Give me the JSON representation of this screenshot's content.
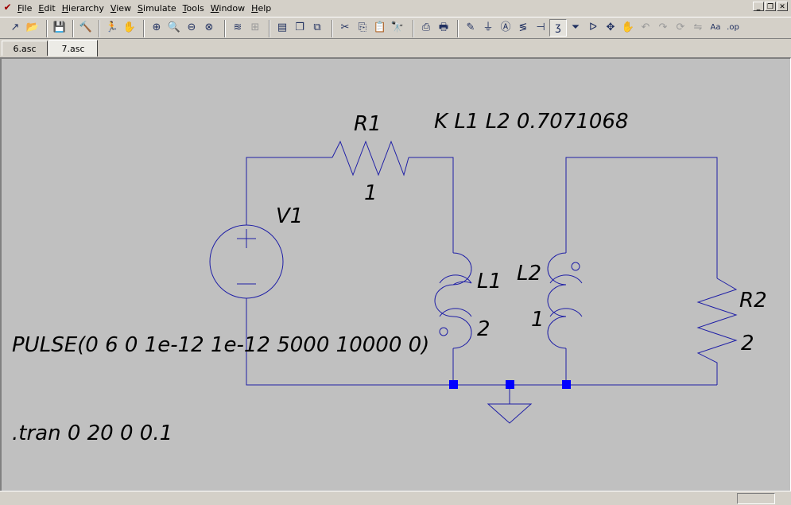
{
  "menu": {
    "items": [
      {
        "accel": "F",
        "rest": "ile"
      },
      {
        "accel": "E",
        "rest": "dit"
      },
      {
        "accel": "H",
        "rest": "ierarchy"
      },
      {
        "accel": "V",
        "rest": "iew"
      },
      {
        "accel": "S",
        "rest": "imulate"
      },
      {
        "accel": "T",
        "rest": "ools"
      },
      {
        "accel": "W",
        "rest": "indow"
      },
      {
        "accel": "H",
        "rest": "elp"
      }
    ]
  },
  "toolbar": {
    "groups": [
      [
        {
          "name": "run-icon",
          "glyph": "↗"
        },
        {
          "name": "open-icon",
          "glyph": "📂"
        }
      ],
      [
        {
          "name": "save-icon",
          "glyph": "💾"
        }
      ],
      [
        {
          "name": "control-panel-icon",
          "glyph": "🔨"
        }
      ],
      [
        {
          "name": "run-simulation-icon",
          "glyph": "🏃"
        },
        {
          "name": "halt-icon",
          "glyph": "✋",
          "gray": true
        }
      ],
      [
        {
          "name": "zoom-in-icon",
          "glyph": "⊕"
        },
        {
          "name": "zoom-area-icon",
          "glyph": "🔍",
          "gray": true
        },
        {
          "name": "zoom-out-icon",
          "glyph": "⊖"
        },
        {
          "name": "zoom-fit-icon",
          "glyph": "⊗"
        }
      ],
      [
        {
          "name": "waveform-icon",
          "glyph": "≋"
        },
        {
          "name": "autorange-icon",
          "glyph": "⊞",
          "gray": true
        }
      ],
      [
        {
          "name": "tile-horizontal-icon",
          "glyph": "▤"
        },
        {
          "name": "cascade-icon",
          "glyph": "❐"
        },
        {
          "name": "close-all-icon",
          "glyph": "⧉"
        }
      ],
      [
        {
          "name": "cut-icon",
          "glyph": "✂"
        },
        {
          "name": "copy-icon",
          "glyph": "⎘"
        },
        {
          "name": "paste-icon",
          "glyph": "📋"
        },
        {
          "name": "find-icon",
          "glyph": "🔭"
        }
      ],
      [
        {
          "name": "print-setup-icon",
          "glyph": "⎙"
        },
        {
          "name": "print-icon",
          "glyph": "🖶"
        }
      ],
      [
        {
          "name": "draw-wire-icon",
          "glyph": "✎"
        },
        {
          "name": "ground-icon",
          "glyph": "⏚"
        },
        {
          "name": "label-net-icon",
          "glyph": "Ⓐ"
        },
        {
          "name": "resistor-icon",
          "glyph": "≶"
        },
        {
          "name": "capacitor-icon",
          "glyph": "⊣"
        },
        {
          "name": "inductor-icon",
          "glyph": "ʒ",
          "active": true
        },
        {
          "name": "diode-icon",
          "glyph": "⏷"
        },
        {
          "name": "component-icon",
          "glyph": "ᐅ"
        },
        {
          "name": "move-icon",
          "glyph": "✥"
        },
        {
          "name": "drag-icon",
          "glyph": "✋"
        },
        {
          "name": "undo-icon",
          "glyph": "↶",
          "gray": true
        },
        {
          "name": "redo-icon",
          "glyph": "↷",
          "gray": true
        },
        {
          "name": "rotate-icon",
          "glyph": "⟳",
          "gray": true
        },
        {
          "name": "mirror-icon",
          "glyph": "⇋",
          "gray": true
        },
        {
          "name": "text-icon",
          "glyph": "Aa"
        },
        {
          "name": "spice-directive-icon",
          "glyph": ".op"
        }
      ]
    ]
  },
  "tabs": [
    {
      "label": "6.asc",
      "active": false
    },
    {
      "label": "7.asc",
      "active": true
    }
  ],
  "schematic": {
    "wire_color": "#1f1fa6",
    "junction_color": "#0000ff",
    "labels": {
      "r1_name": "R1",
      "r1_value": "1",
      "v1_name": "V1",
      "v1_value": "PULSE(0 6 0 1e-12 1e-12 5000 10000 0)",
      "l1_name": "L1",
      "l1_value": "2",
      "l2_name": "L2",
      "l2_value": "1",
      "r2_name": "R2",
      "r2_value": "2",
      "coupling_directive": "K L1 L2 0.7071068",
      "tran_directive": ".tran 0 20 0 0.1"
    }
  },
  "status": {
    "panel_text": ""
  }
}
